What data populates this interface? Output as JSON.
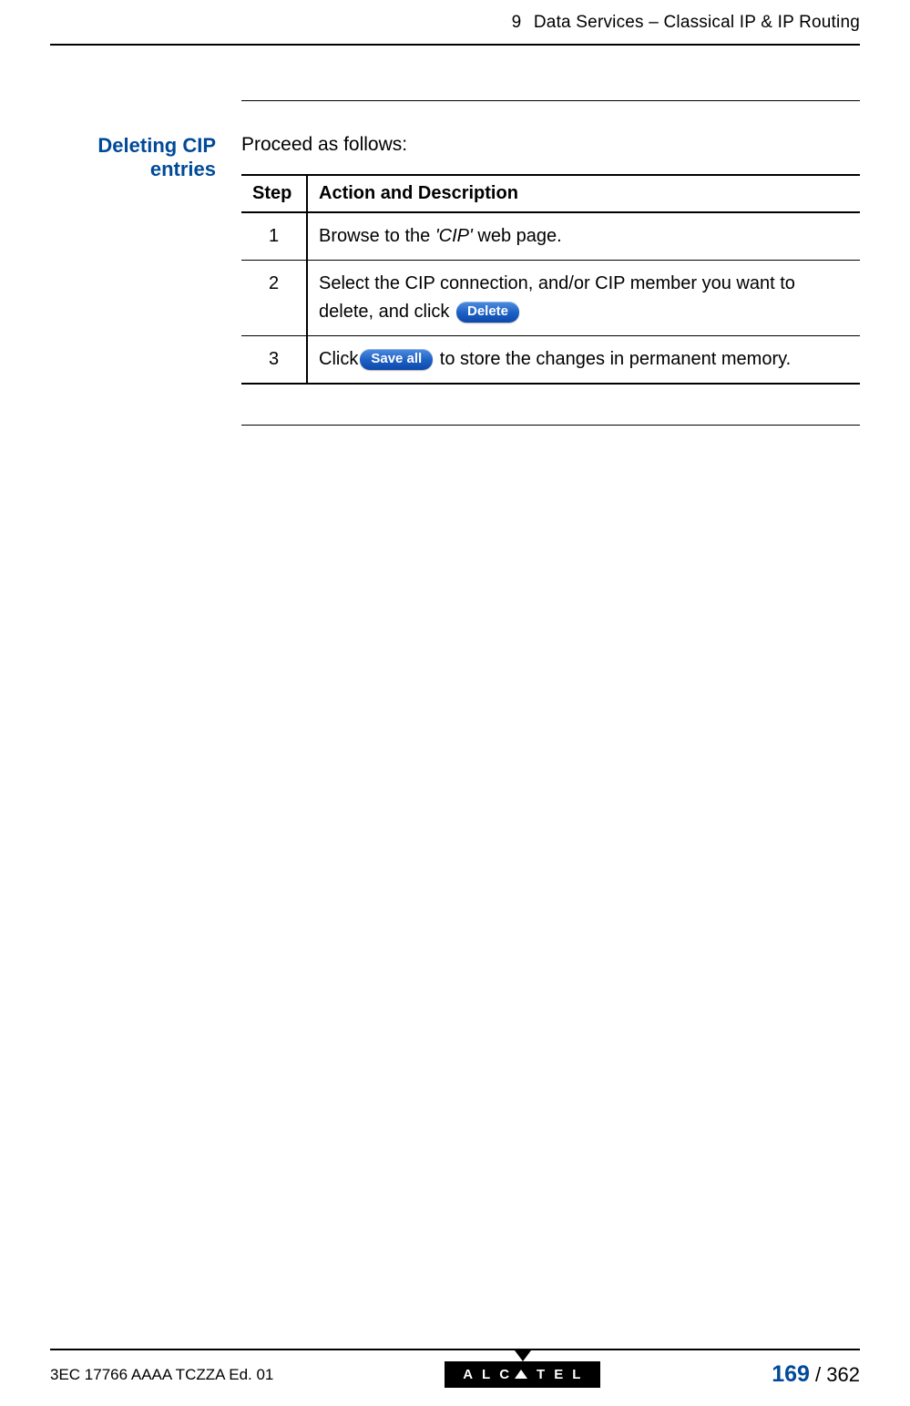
{
  "header": {
    "chapter_number": "9",
    "chapter_title": "Data Services – Classical IP & IP Routing"
  },
  "section": {
    "title": "Deleting CIP entries",
    "lead": "Proceed as follows:"
  },
  "table": {
    "headers": {
      "step": "Step",
      "desc": "Action and Description"
    },
    "rows": [
      {
        "step": "1",
        "desc_pre": "Browse to the ",
        "desc_em": "'CIP'",
        "desc_post": " web page."
      },
      {
        "step": "2",
        "desc_pre": "Select the CIP connection, and/or CIP member you want to delete, and click ",
        "button_label": "Delete",
        "desc_post": ""
      },
      {
        "step": "3",
        "desc_pre": "Click",
        "button_label": "Save all",
        "desc_post": "  to store the changes in permanent memory."
      }
    ]
  },
  "footer": {
    "doc_code": "3EC 17766 AAAA TCZZA Ed. 01",
    "logo_text": "ALCATEL",
    "page_current": "169",
    "page_total": "362",
    "page_sep": " / "
  }
}
